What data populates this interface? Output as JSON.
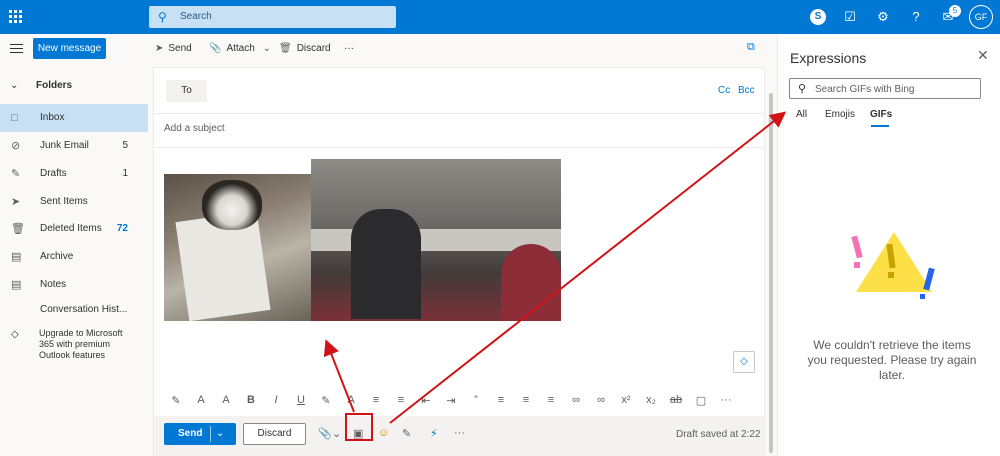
{
  "topbar": {
    "search_placeholder": "Search",
    "notifications_count": "5",
    "avatar_initials": "GF"
  },
  "nav": {
    "new_message": "New message",
    "folders_label": "Folders",
    "items": [
      {
        "label": "Inbox",
        "count": "",
        "icon": "inbox-icon"
      },
      {
        "label": "Junk Email",
        "count": "5",
        "icon": "junk-icon"
      },
      {
        "label": "Drafts",
        "count": "1",
        "icon": "drafts-icon"
      },
      {
        "label": "Sent Items",
        "count": "",
        "icon": "sent-icon"
      },
      {
        "label": "Deleted Items",
        "count": "72",
        "icon": "trash-icon"
      },
      {
        "label": "Archive",
        "count": "",
        "icon": "archive-icon"
      },
      {
        "label": "Notes",
        "count": "",
        "icon": "notes-icon"
      },
      {
        "label": "Conversation Hist...",
        "count": "",
        "icon": ""
      }
    ],
    "upgrade_text": "Upgrade to Microsoft 365 with premium Outlook features"
  },
  "commands": {
    "send": "Send",
    "attach": "Attach",
    "discard": "Discard"
  },
  "compose": {
    "to_label": "To",
    "cc_label": "Cc",
    "bcc_label": "Bcc",
    "subject_placeholder": "Add a subject",
    "send_button": "Send",
    "discard_button": "Discard",
    "draft_status": "Draft saved at 2:22"
  },
  "expressions": {
    "title": "Expressions",
    "search_placeholder": "Search GIFs with Bing",
    "tabs": [
      "All",
      "Emojis",
      "GIFs"
    ],
    "active_tab": "GIFs",
    "error_message": "We couldn't retrieve the items you requested. Please try again later."
  },
  "colors": {
    "brand": "#0078d4",
    "highlight": "#d01317"
  }
}
